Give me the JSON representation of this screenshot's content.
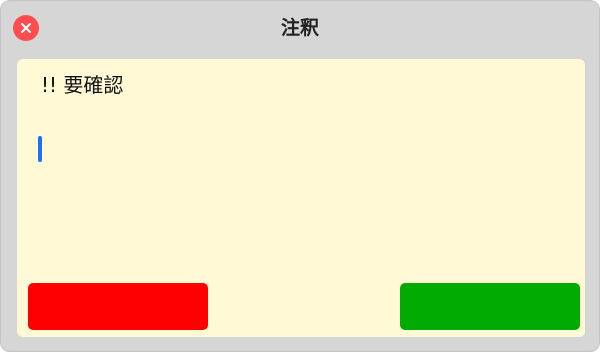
{
  "window": {
    "title": "注釈"
  },
  "note": {
    "text": "!! 要確認",
    "background_color": "#fff9d6"
  },
  "caret": {
    "color": "#1f6fff"
  },
  "buttons": {
    "left": {
      "color": "#ff0000",
      "label": ""
    },
    "right": {
      "color": "#00aa00",
      "label": ""
    }
  },
  "icons": {
    "close": "close-icon"
  }
}
